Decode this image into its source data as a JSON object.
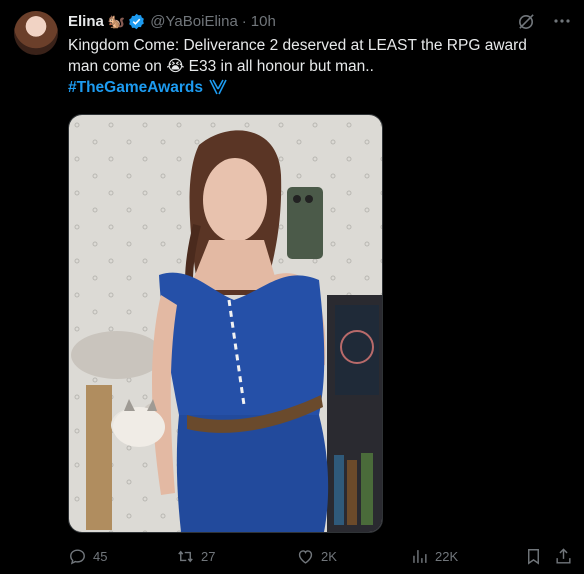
{
  "author": {
    "name": "Elina",
    "emoji": "🐿️",
    "handle": "@YaBoiElina",
    "separator": "·",
    "time": "10h"
  },
  "tweet": {
    "line1": "Kingdom Come: Deliverance 2 deserved at LEAST the RPG award",
    "line2": "man come on 😭 E33 in all honour but man..",
    "hashtag": "#TheGameAwards"
  },
  "icons": {
    "verified": "verified-badge-icon",
    "grok": "grok-icon",
    "more": "more-icon",
    "hashtag_emblem": "game-awards-icon"
  },
  "actions": {
    "replies": "45",
    "retweets": "27",
    "likes": "2K",
    "views": "22K"
  },
  "colors": {
    "background": "#000000",
    "text": "#e7e9ea",
    "muted": "#71767b",
    "accent": "#1d9bf0"
  }
}
